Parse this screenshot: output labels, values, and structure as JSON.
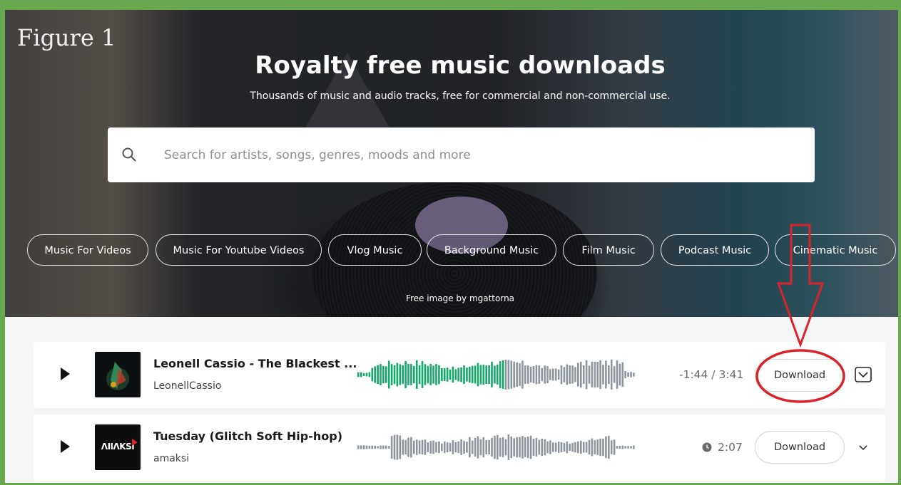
{
  "figure_label": "Figure 1",
  "hero": {
    "title": "Royalty free music downloads",
    "subtitle": "Thousands of music and audio tracks, free for commercial and non-commercial use.",
    "credit": "Free image by mgattorna"
  },
  "search": {
    "placeholder": "Search for artists, songs, genres, moods and more",
    "icon": "search-icon"
  },
  "categories": [
    "Music For Videos",
    "Music For Youtube Videos",
    "Vlog Music",
    "Background Music",
    "Film Music",
    "Podcast Music",
    "Cinematic Music"
  ],
  "tracks": [
    {
      "title": "Leonell Cassio - The Blackest ...",
      "artist": "LeonellCassio",
      "time": "-1:44 / 3:41",
      "download_label": "Download",
      "progress": 0.53,
      "expand_icon": "chevron-down-boxed-icon"
    },
    {
      "title": "Tuesday (Glitch Soft Hip-hop)",
      "artist": "amaksi",
      "duration": "2:07",
      "download_label": "Download",
      "cover_text": "ΛΙΙΛΚSΙ",
      "progress": 0,
      "expand_icon": "chevron-down-icon"
    }
  ],
  "colors": {
    "frame": "#6aa84f",
    "waveform_played": "#14a86a",
    "waveform_unplayed": "#8e959c",
    "annotation": "#d9232a"
  }
}
